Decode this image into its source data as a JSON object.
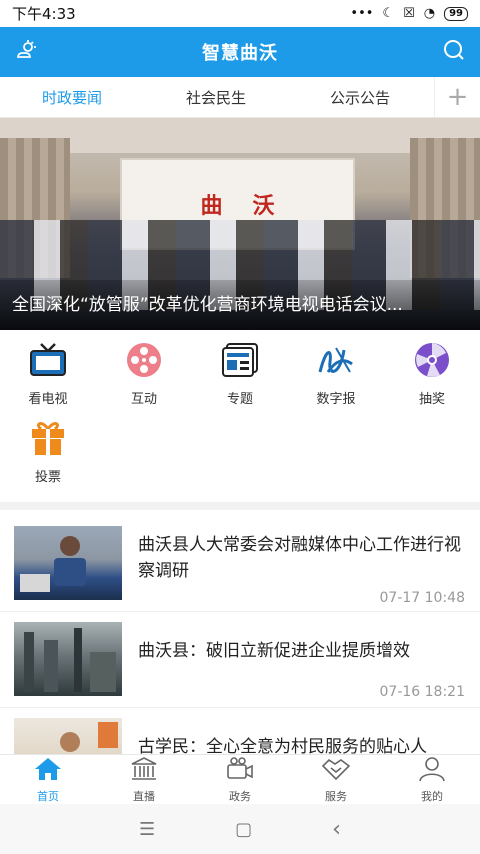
{
  "status_bar": {
    "time": "下午4:33",
    "dots": "•••",
    "moon": "☾",
    "sim": "☒",
    "wifi": "◔",
    "battery": "99"
  },
  "app_bar": {
    "title": "智慧曲沃"
  },
  "tabs": [
    {
      "label": "时政要闻",
      "active": true
    },
    {
      "label": "社会民生"
    },
    {
      "label": "公示公告"
    }
  ],
  "tab_add": "+",
  "hero": {
    "banner_text": [
      "曲",
      "沃"
    ],
    "caption": "全国深化“放管服”改革优化营商环境电视电话会议..."
  },
  "shortcuts": [
    {
      "label": "看电视",
      "icon": "tv-icon"
    },
    {
      "label": "互动",
      "icon": "film-reel-icon"
    },
    {
      "label": "专题",
      "icon": "topic-icon"
    },
    {
      "label": "数字报",
      "icon": "digital-paper-icon"
    },
    {
      "label": "抽奖",
      "icon": "lottery-wheel-icon"
    },
    {
      "label": "投票",
      "icon": "gift-box-icon"
    }
  ],
  "news": [
    {
      "title": "曲沃县人大常委会对融媒体中心工作进行视察调研",
      "time": "07-17 10:48"
    },
    {
      "title": "曲沃县：破旧立新促进企业提质增效",
      "time": "07-16 18:21"
    },
    {
      "title": "古学民：全心全意为村民服务的贴心人"
    }
  ],
  "bottom_nav": [
    {
      "label": "首页",
      "icon": "home-icon",
      "active": true
    },
    {
      "label": "直播",
      "icon": "live-building-icon"
    },
    {
      "label": "政务",
      "icon": "video-camera-icon"
    },
    {
      "label": "服务",
      "icon": "handshake-icon"
    },
    {
      "label": "我的",
      "icon": "user-icon"
    }
  ],
  "system_nav": {
    "menu": "☰",
    "home": "▢",
    "back": "‹"
  },
  "colors": {
    "accent": "#1e9be8",
    "tv": "#1c6fb6",
    "pink": "#ec7f8a",
    "gift": "#ef8a1c",
    "wheel": "#7b4fc9"
  }
}
